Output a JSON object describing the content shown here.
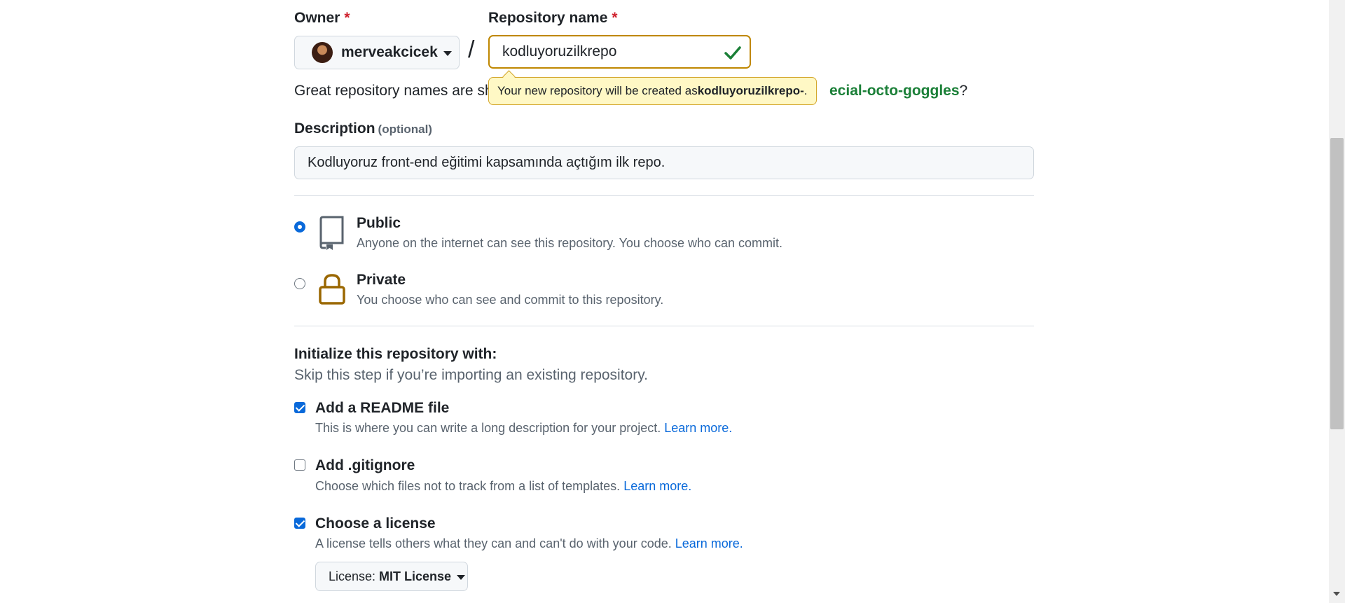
{
  "owner": {
    "label": "Owner",
    "required_mark": "*",
    "value": "merveakcicek"
  },
  "repo": {
    "label": "Repository name",
    "required_mark": "*",
    "value": "kodluyoruzilkrepo",
    "separator": "/"
  },
  "hint": {
    "prefix": "Great repository names are sh",
    "suggestion_tail": "ecial-octo-goggles",
    "suffix": "?"
  },
  "tooltip": {
    "text": "Your new repository will be created as ",
    "name": "kodluyoruzilkrepo-",
    "period": "."
  },
  "description": {
    "label": "Description",
    "optional": "(optional)",
    "value": "Kodluyoruz front-end eğitimi kapsamında açtığım ilk repo."
  },
  "visibility": {
    "public": {
      "title": "Public",
      "subtitle": "Anyone on the internet can see this repository. You choose who can commit.",
      "checked": true,
      "icon": "repo-icon"
    },
    "private": {
      "title": "Private",
      "subtitle": "You choose who can see and commit to this repository.",
      "checked": false,
      "icon": "lock-icon"
    }
  },
  "init": {
    "title": "Initialize this repository with:",
    "subtitle": "Skip this step if you’re importing an existing repository.",
    "readme": {
      "title": "Add a README file",
      "subtitle": "This is where you can write a long description for your project.",
      "link": "Learn more.",
      "checked": true
    },
    "gitignore": {
      "title": "Add .gitignore",
      "subtitle": "Choose which files not to track from a list of templates.",
      "link": "Learn more.",
      "checked": false
    },
    "license": {
      "title": "Choose a license",
      "subtitle": "A license tells others what they can and can't do with your code.",
      "link": "Learn more.",
      "checked": true,
      "select_prefix": "License:",
      "select_value": "MIT License"
    }
  },
  "colors": {
    "accent": "#0969da",
    "success": "#1a7f37",
    "required": "#cf222e",
    "warning_border": "#bf8700",
    "tooltip_bg": "#fff8c5",
    "lock": "#9a6700"
  }
}
